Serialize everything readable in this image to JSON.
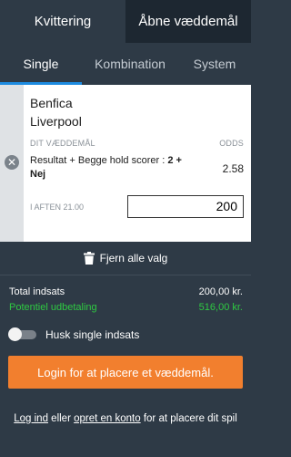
{
  "top_tabs": {
    "receipt": "Kvittering",
    "open_bets": "Åbne væddemål"
  },
  "sub_tabs": {
    "single": "Single",
    "combination": "Kombination",
    "system": "System"
  },
  "bet": {
    "team_home": "Benfica",
    "team_away": "Liverpool",
    "your_bet_label": "DIT VÆDDEMÅL",
    "odds_label": "ODDS",
    "selection_prefix": "Resultat + Begge hold scorer : ",
    "selection_value": "2 + Nej",
    "odds": "2.58",
    "time": "I AFTEN 21.00",
    "stake_value": "200"
  },
  "clear_all": "Fjern alle valg",
  "summary": {
    "total_label": "Total indsats",
    "total_value": "200,00 kr.",
    "payout_label": "Potentiel udbetaling",
    "payout_value": "516,00 kr."
  },
  "remember_toggle": {
    "label": "Husk single indsats",
    "on": false
  },
  "login_button": "Login for at placere et væddemål.",
  "footer": {
    "login_link": "Log ind",
    "or": "eller",
    "create_link": "opret en konto",
    "suffix": "for at placere dit spil"
  },
  "colors": {
    "accent_orange": "#f27f2e",
    "tab_underline": "#1d8be0",
    "payout_green": "#2ec942"
  },
  "icons": {
    "remove": "close-circle-icon",
    "trash": "trash-icon"
  }
}
